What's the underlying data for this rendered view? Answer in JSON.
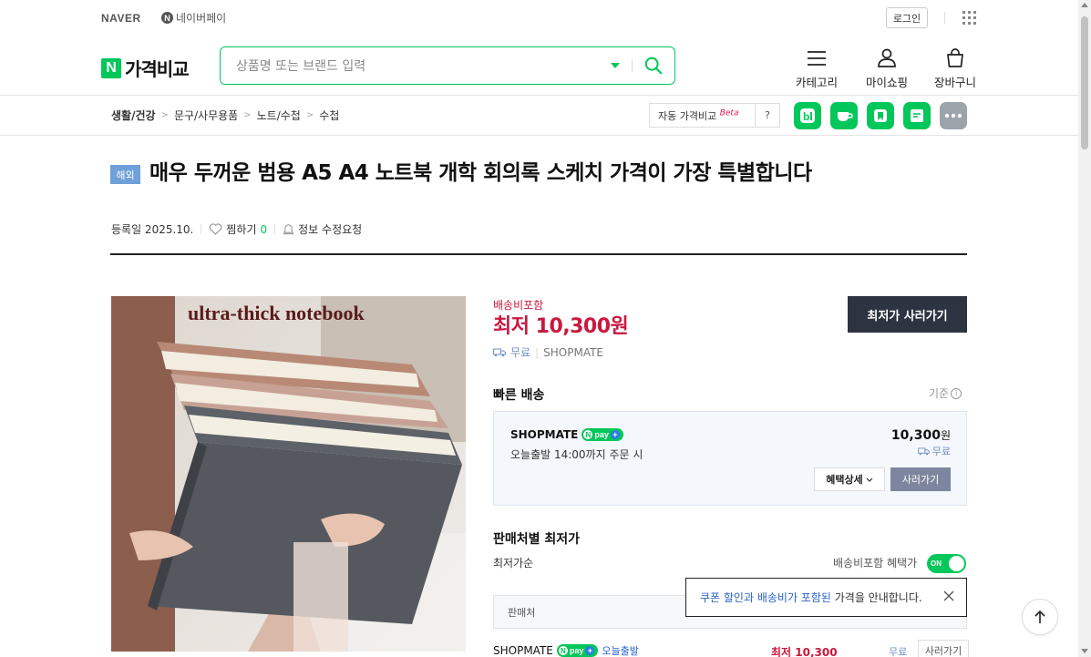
{
  "topbar": {
    "naver_label": "NAVER",
    "npay_label": "네이버페이",
    "login_label": "로그인"
  },
  "header": {
    "logo_n": "N",
    "logo_text": "가격비교",
    "search_placeholder": "상품명 또는 브랜드 입력",
    "nav_items": [
      {
        "label": "카테고리",
        "icon": "menu-icon"
      },
      {
        "label": "마이쇼핑",
        "icon": "user-icon"
      },
      {
        "label": "장바구니",
        "icon": "cart-icon"
      }
    ]
  },
  "breadcrumb": [
    "생활/건강",
    "문구/사무용품",
    "노트/수첩",
    "수첩"
  ],
  "auto_compare": {
    "label": "자동 가격비교",
    "beta": "Beta",
    "help": "?"
  },
  "share_buttons": [
    "blog-share",
    "cafe-share",
    "keep-share",
    "note-share",
    "more-share"
  ],
  "product": {
    "badge": "해외",
    "title": "매우 두꺼운 범용 A5 A4 노트북 개학 회의록 스케치 가격이 가장 특별합니다",
    "registered": "등록일 2025.10.",
    "zzim_label": "찜하기",
    "zzim_count": "0",
    "report_label": "정보 수정요청",
    "image_caption": "ultra-thick notebook"
  },
  "price": {
    "shipping_included": "배송비포함",
    "lowest": "최저 10,300원",
    "ship_free": "무료",
    "seller": "SHOPMATE",
    "buy_lowest": "최저가 사러가기"
  },
  "fast_delivery": {
    "title": "빠른 배송",
    "criteria": "기준",
    "seller": "SHOPMATE",
    "delivery_note": "오늘출발 14:00까지 주문 시",
    "price": "10,300",
    "price_unit": "원",
    "ship": "무료",
    "benefit_label": "혜택상세",
    "go_label": "사러가기"
  },
  "seller_lowest": {
    "title": "판매처별 최저가",
    "sort_label": "최저가순",
    "toggle_label": "배송비포함 혜택가",
    "toggle_state": "ON",
    "col_seller": "판매처",
    "tooltip_highlight": "쿠폰 할인과 배송비가 포함된",
    "tooltip_rest": " 가격을 안내합니다.",
    "rows": [
      {
        "seller": "SHOPMATE",
        "tag": "오늘출발",
        "price": "최저 10,300",
        "ship": "무료",
        "go": "사러가기"
      }
    ]
  },
  "npay": {
    "n": "N",
    "pay": "pay",
    "plus": "+"
  },
  "colors": {
    "brand_green": "#03c75a",
    "price_red": "#c9183f",
    "dark_button": "#2d3341"
  }
}
